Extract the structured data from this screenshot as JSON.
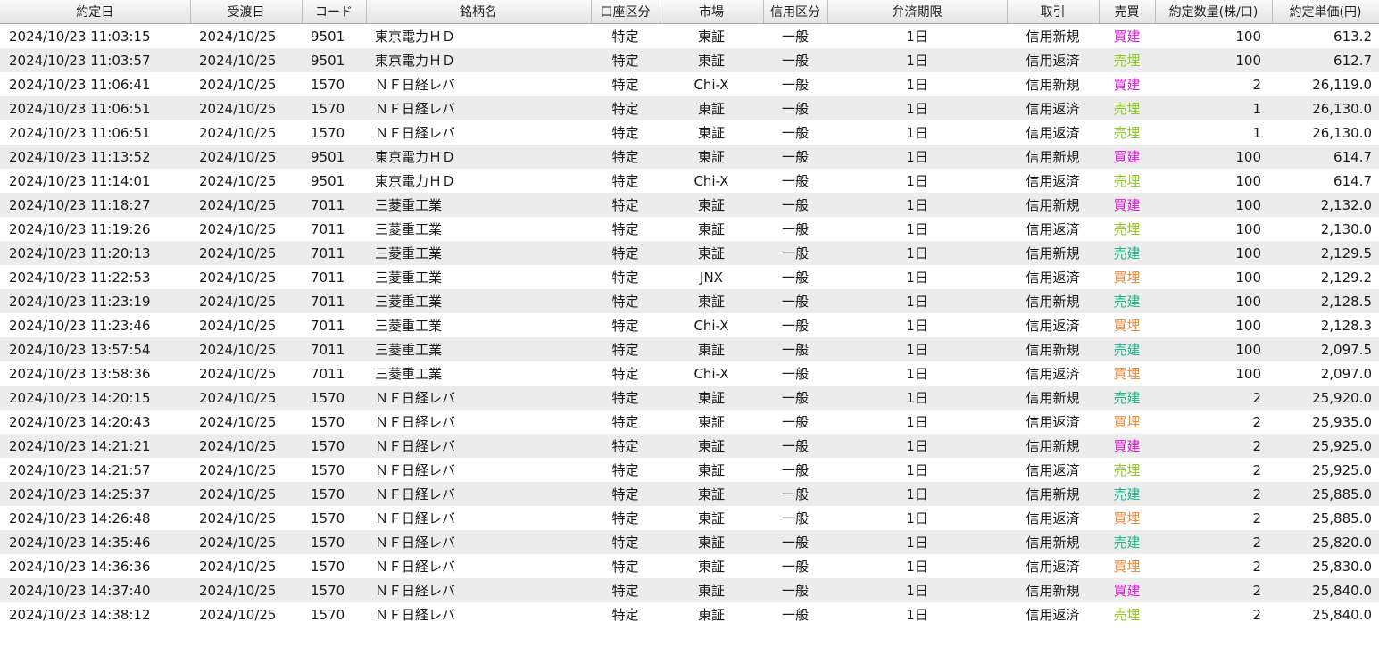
{
  "columns": [
    "約定日",
    "受渡日",
    "コード",
    "銘柄名",
    "口座区分",
    "市場",
    "信用区分",
    "弁済期限",
    "取引",
    "売買",
    "約定数量(株/口)",
    "約定単価(円)"
  ],
  "side_colors": {
    "買建": "#e017d8",
    "売埋": "#8fcc1e",
    "売建": "#1bb88b",
    "買埋": "#f2883a"
  },
  "rows": [
    {
      "date": "2024/10/23 11:03:15",
      "settle": "2024/10/25",
      "code": "9501",
      "name": "東京電力ＨＤ",
      "account": "特定",
      "market": "東証",
      "margin": "一般",
      "term": "1日",
      "trade": "信用新規",
      "side": "買建",
      "qty": "100",
      "price": "613.2"
    },
    {
      "date": "2024/10/23 11:03:57",
      "settle": "2024/10/25",
      "code": "9501",
      "name": "東京電力ＨＤ",
      "account": "特定",
      "market": "東証",
      "margin": "一般",
      "term": "1日",
      "trade": "信用返済",
      "side": "売埋",
      "qty": "100",
      "price": "612.7"
    },
    {
      "date": "2024/10/23 11:06:41",
      "settle": "2024/10/25",
      "code": "1570",
      "name": "ＮＦ日経レバ",
      "account": "特定",
      "market": "Chi-X",
      "margin": "一般",
      "term": "1日",
      "trade": "信用新規",
      "side": "買建",
      "qty": "2",
      "price": "26,119.0"
    },
    {
      "date": "2024/10/23 11:06:51",
      "settle": "2024/10/25",
      "code": "1570",
      "name": "ＮＦ日経レバ",
      "account": "特定",
      "market": "東証",
      "margin": "一般",
      "term": "1日",
      "trade": "信用返済",
      "side": "売埋",
      "qty": "1",
      "price": "26,130.0"
    },
    {
      "date": "2024/10/23 11:06:51",
      "settle": "2024/10/25",
      "code": "1570",
      "name": "ＮＦ日経レバ",
      "account": "特定",
      "market": "東証",
      "margin": "一般",
      "term": "1日",
      "trade": "信用返済",
      "side": "売埋",
      "qty": "1",
      "price": "26,130.0"
    },
    {
      "date": "2024/10/23 11:13:52",
      "settle": "2024/10/25",
      "code": "9501",
      "name": "東京電力ＨＤ",
      "account": "特定",
      "market": "東証",
      "margin": "一般",
      "term": "1日",
      "trade": "信用新規",
      "side": "買建",
      "qty": "100",
      "price": "614.7"
    },
    {
      "date": "2024/10/23 11:14:01",
      "settle": "2024/10/25",
      "code": "9501",
      "name": "東京電力ＨＤ",
      "account": "特定",
      "market": "Chi-X",
      "margin": "一般",
      "term": "1日",
      "trade": "信用返済",
      "side": "売埋",
      "qty": "100",
      "price": "614.7"
    },
    {
      "date": "2024/10/23 11:18:27",
      "settle": "2024/10/25",
      "code": "7011",
      "name": "三菱重工業",
      "account": "特定",
      "market": "東証",
      "margin": "一般",
      "term": "1日",
      "trade": "信用新規",
      "side": "買建",
      "qty": "100",
      "price": "2,132.0"
    },
    {
      "date": "2024/10/23 11:19:26",
      "settle": "2024/10/25",
      "code": "7011",
      "name": "三菱重工業",
      "account": "特定",
      "market": "東証",
      "margin": "一般",
      "term": "1日",
      "trade": "信用返済",
      "side": "売埋",
      "qty": "100",
      "price": "2,130.0"
    },
    {
      "date": "2024/10/23 11:20:13",
      "settle": "2024/10/25",
      "code": "7011",
      "name": "三菱重工業",
      "account": "特定",
      "market": "東証",
      "margin": "一般",
      "term": "1日",
      "trade": "信用新規",
      "side": "売建",
      "qty": "100",
      "price": "2,129.5"
    },
    {
      "date": "2024/10/23 11:22:53",
      "settle": "2024/10/25",
      "code": "7011",
      "name": "三菱重工業",
      "account": "特定",
      "market": "JNX",
      "margin": "一般",
      "term": "1日",
      "trade": "信用返済",
      "side": "買埋",
      "qty": "100",
      "price": "2,129.2"
    },
    {
      "date": "2024/10/23 11:23:19",
      "settle": "2024/10/25",
      "code": "7011",
      "name": "三菱重工業",
      "account": "特定",
      "market": "東証",
      "margin": "一般",
      "term": "1日",
      "trade": "信用新規",
      "side": "売建",
      "qty": "100",
      "price": "2,128.5"
    },
    {
      "date": "2024/10/23 11:23:46",
      "settle": "2024/10/25",
      "code": "7011",
      "name": "三菱重工業",
      "account": "特定",
      "market": "Chi-X",
      "margin": "一般",
      "term": "1日",
      "trade": "信用返済",
      "side": "買埋",
      "qty": "100",
      "price": "2,128.3"
    },
    {
      "date": "2024/10/23 13:57:54",
      "settle": "2024/10/25",
      "code": "7011",
      "name": "三菱重工業",
      "account": "特定",
      "market": "東証",
      "margin": "一般",
      "term": "1日",
      "trade": "信用新規",
      "side": "売建",
      "qty": "100",
      "price": "2,097.5"
    },
    {
      "date": "2024/10/23 13:58:36",
      "settle": "2024/10/25",
      "code": "7011",
      "name": "三菱重工業",
      "account": "特定",
      "market": "Chi-X",
      "margin": "一般",
      "term": "1日",
      "trade": "信用返済",
      "side": "買埋",
      "qty": "100",
      "price": "2,097.0"
    },
    {
      "date": "2024/10/23 14:20:15",
      "settle": "2024/10/25",
      "code": "1570",
      "name": "ＮＦ日経レバ",
      "account": "特定",
      "market": "東証",
      "margin": "一般",
      "term": "1日",
      "trade": "信用新規",
      "side": "売建",
      "qty": "2",
      "price": "25,920.0"
    },
    {
      "date": "2024/10/23 14:20:43",
      "settle": "2024/10/25",
      "code": "1570",
      "name": "ＮＦ日経レバ",
      "account": "特定",
      "market": "東証",
      "margin": "一般",
      "term": "1日",
      "trade": "信用返済",
      "side": "買埋",
      "qty": "2",
      "price": "25,935.0"
    },
    {
      "date": "2024/10/23 14:21:21",
      "settle": "2024/10/25",
      "code": "1570",
      "name": "ＮＦ日経レバ",
      "account": "特定",
      "market": "東証",
      "margin": "一般",
      "term": "1日",
      "trade": "信用新規",
      "side": "買建",
      "qty": "2",
      "price": "25,925.0"
    },
    {
      "date": "2024/10/23 14:21:57",
      "settle": "2024/10/25",
      "code": "1570",
      "name": "ＮＦ日経レバ",
      "account": "特定",
      "market": "東証",
      "margin": "一般",
      "term": "1日",
      "trade": "信用返済",
      "side": "売埋",
      "qty": "2",
      "price": "25,925.0"
    },
    {
      "date": "2024/10/23 14:25:37",
      "settle": "2024/10/25",
      "code": "1570",
      "name": "ＮＦ日経レバ",
      "account": "特定",
      "market": "東証",
      "margin": "一般",
      "term": "1日",
      "trade": "信用新規",
      "side": "売建",
      "qty": "2",
      "price": "25,885.0"
    },
    {
      "date": "2024/10/23 14:26:48",
      "settle": "2024/10/25",
      "code": "1570",
      "name": "ＮＦ日経レバ",
      "account": "特定",
      "market": "東証",
      "margin": "一般",
      "term": "1日",
      "trade": "信用返済",
      "side": "買埋",
      "qty": "2",
      "price": "25,885.0"
    },
    {
      "date": "2024/10/23 14:35:46",
      "settle": "2024/10/25",
      "code": "1570",
      "name": "ＮＦ日経レバ",
      "account": "特定",
      "market": "東証",
      "margin": "一般",
      "term": "1日",
      "trade": "信用新規",
      "side": "売建",
      "qty": "2",
      "price": "25,820.0"
    },
    {
      "date": "2024/10/23 14:36:36",
      "settle": "2024/10/25",
      "code": "1570",
      "name": "ＮＦ日経レバ",
      "account": "特定",
      "market": "東証",
      "margin": "一般",
      "term": "1日",
      "trade": "信用返済",
      "side": "買埋",
      "qty": "2",
      "price": "25,830.0"
    },
    {
      "date": "2024/10/23 14:37:40",
      "settle": "2024/10/25",
      "code": "1570",
      "name": "ＮＦ日経レバ",
      "account": "特定",
      "market": "東証",
      "margin": "一般",
      "term": "1日",
      "trade": "信用新規",
      "side": "買建",
      "qty": "2",
      "price": "25,840.0"
    },
    {
      "date": "2024/10/23 14:38:12",
      "settle": "2024/10/25",
      "code": "1570",
      "name": "ＮＦ日経レバ",
      "account": "特定",
      "market": "東証",
      "margin": "一般",
      "term": "1日",
      "trade": "信用返済",
      "side": "売埋",
      "qty": "2",
      "price": "25,840.0"
    }
  ]
}
